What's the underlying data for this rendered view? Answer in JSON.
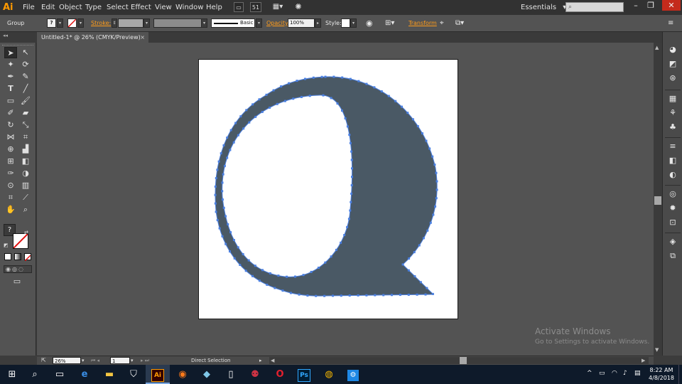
{
  "app": {
    "logo": "Ai"
  },
  "menu": [
    "File",
    "Edit",
    "Object",
    "Type",
    "Select",
    "Effect",
    "View",
    "Window",
    "Help"
  ],
  "menubar_icons": {
    "arrange_num": "51"
  },
  "workspace": {
    "label": "Essentials",
    "arrow": "▾"
  },
  "search": {
    "placeholder": ""
  },
  "window_controls": {
    "minimize": "–",
    "restore": "❐",
    "close": "✕"
  },
  "control_bar": {
    "selection_label": "Group",
    "fill_icon": "?",
    "stroke_label": "Stroke:",
    "stroke_profile": "Basic",
    "opacity_label": "Opacity:",
    "opacity_value": "100%",
    "style_label": "Style:",
    "transform_label": "Transform"
  },
  "document_tab": {
    "title": "Untitled-1* @ 26% (CMYK/Preview)",
    "close": "×"
  },
  "status_bar": {
    "zoom": "26%",
    "page": "1",
    "tool": "Direct Selection"
  },
  "watermark": {
    "title": "Activate Windows",
    "subtitle": "Go to Settings to activate Windows."
  },
  "artwork": {
    "fill_color": "#4a5965",
    "path_color": "#4a7fe0"
  },
  "taskbar": {
    "ai_label": "Ai",
    "ps_label": "Ps",
    "time": "8:22 AM",
    "date": "4/8/2018"
  },
  "colors": {
    "menubar": "#323232",
    "panel": "#535353",
    "accent_orange": "#ff9c1a",
    "taskbar": "#0e1a2a"
  }
}
